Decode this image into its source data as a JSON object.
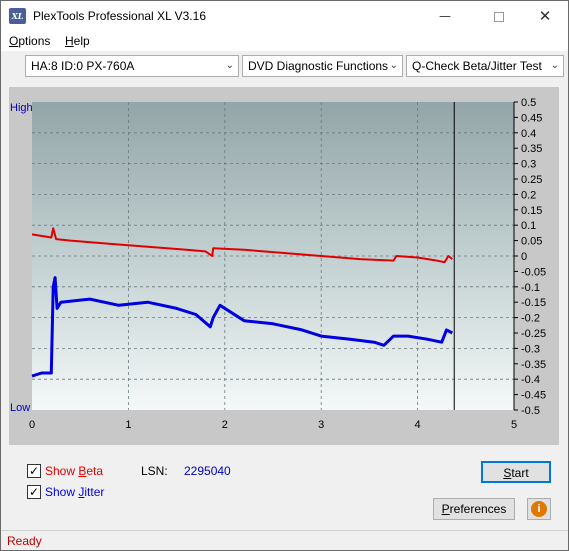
{
  "window": {
    "title": "PlexTools Professional XL V3.16",
    "icon_label": "XL",
    "controls": [
      "minimize-icon",
      "maximize-icon",
      "close-icon"
    ]
  },
  "menu": {
    "options_first": "O",
    "options_rest": "ptions",
    "help_first": "H",
    "help_rest": "elp"
  },
  "toolbar": {
    "drive": "HA:8 ID:0  PX-760A",
    "function": "DVD Diagnostic Functions",
    "test": "Q-Check Beta/Jitter Test"
  },
  "chart_data": {
    "type": "line",
    "x_ticks": [
      "0",
      "1",
      "2",
      "3",
      "4",
      "5"
    ],
    "xlim": [
      0,
      5
    ],
    "y_right_ticks": [
      "0.5",
      "0.45",
      "0.4",
      "0.35",
      "0.3",
      "0.25",
      "0.2",
      "0.15",
      "0.1",
      "0.05",
      "0",
      "-0.05",
      "-0.1",
      "-0.15",
      "-0.2",
      "-0.25",
      "-0.3",
      "-0.35",
      "-0.4",
      "-0.45",
      "-0.5"
    ],
    "ylim": [
      -0.5,
      0.5
    ],
    "y_left_top": "High",
    "y_left_bottom": "Low",
    "end_marker_x": 4.38,
    "grid": true,
    "series": [
      {
        "color": "#e00000",
        "x": [
          0.0,
          0.2,
          0.22,
          0.25,
          0.4,
          0.8,
          1.2,
          1.6,
          1.8,
          1.87,
          1.88,
          2.2,
          2.6,
          3.0,
          3.4,
          3.75,
          3.78,
          4.0,
          4.2,
          4.28,
          4.32,
          4.36
        ],
        "y": [
          0.07,
          0.06,
          0.09,
          0.055,
          0.05,
          0.04,
          0.03,
          0.02,
          0.015,
          0.0,
          0.025,
          0.02,
          0.01,
          0.0,
          -0.01,
          -0.015,
          0.0,
          -0.005,
          -0.015,
          -0.02,
          0.0,
          -0.01
        ]
      },
      {
        "color": "#0000e0",
        "x": [
          0.0,
          0.1,
          0.2,
          0.22,
          0.24,
          0.26,
          0.3,
          0.6,
          0.9,
          1.2,
          1.5,
          1.7,
          1.85,
          1.88,
          1.95,
          2.2,
          2.5,
          2.8,
          3.0,
          3.3,
          3.55,
          3.65,
          3.75,
          3.9,
          4.1,
          4.25,
          4.3,
          4.36
        ],
        "y": [
          -0.39,
          -0.38,
          -0.38,
          -0.1,
          -0.07,
          -0.17,
          -0.15,
          -0.14,
          -0.16,
          -0.15,
          -0.17,
          -0.19,
          -0.23,
          -0.2,
          -0.16,
          -0.21,
          -0.22,
          -0.24,
          -0.26,
          -0.27,
          -0.28,
          -0.29,
          -0.26,
          -0.26,
          -0.27,
          -0.28,
          -0.24,
          -0.25
        ]
      }
    ]
  },
  "controls": {
    "show_beta_first": "Show ",
    "show_beta_u": "B",
    "show_beta_rest": "eta",
    "show_jitter_first": "Show ",
    "show_jitter_u": "J",
    "show_jitter_rest": "itter",
    "check_mark": "✓",
    "lsn_label": "LSN:",
    "lsn_value": "2295040",
    "start_u": "S",
    "start_rest": "tart",
    "prefs_u": "P",
    "prefs_rest": "references",
    "info_glyph": "i"
  },
  "status": {
    "text": "Ready"
  }
}
